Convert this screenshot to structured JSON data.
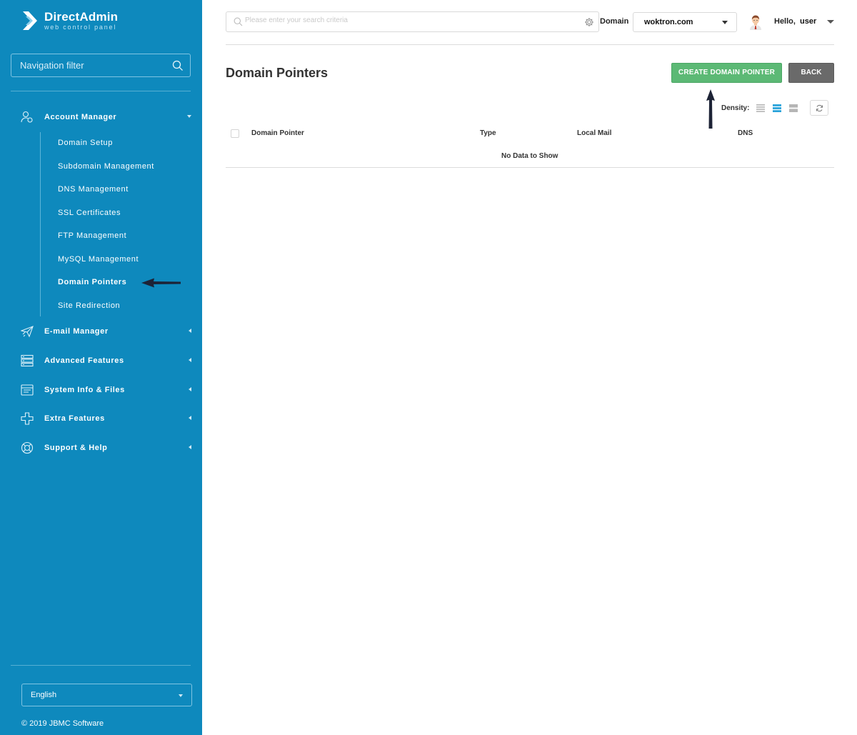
{
  "brand": {
    "name": "DirectAdmin",
    "tagline": "web control panel"
  },
  "sidebar": {
    "filter_placeholder": "Navigation filter",
    "groups": [
      {
        "label": "Account Manager",
        "icon": "account-manager-icon",
        "expanded": true
      },
      {
        "label": "E-mail Manager",
        "icon": "paper-plane-icon",
        "expanded": false
      },
      {
        "label": "Advanced Features",
        "icon": "server-list-icon",
        "expanded": false
      },
      {
        "label": "System Info & Files",
        "icon": "folder-icon",
        "expanded": false
      },
      {
        "label": "Extra Features",
        "icon": "plus-cross-icon",
        "expanded": false
      },
      {
        "label": "Support & Help",
        "icon": "lifebuoy-icon",
        "expanded": false
      }
    ],
    "account_items": [
      {
        "label": "Domain Setup"
      },
      {
        "label": "Subdomain Management"
      },
      {
        "label": "DNS Management"
      },
      {
        "label": "SSL Certificates"
      },
      {
        "label": "FTP Management"
      },
      {
        "label": "MySQL Management"
      },
      {
        "label": "Domain Pointers",
        "active": true
      },
      {
        "label": "Site Redirection"
      }
    ],
    "language": "English",
    "copyright": "© 2019 JBMC Software"
  },
  "topbar": {
    "search_placeholder": "Please enter your search criteria",
    "domain_label": "Domain",
    "domain_value": "woktron.com",
    "hello": "Hello,",
    "username": "user"
  },
  "main": {
    "title": "Domain Pointers",
    "create_button": "CREATE DOMAIN POINTER",
    "back_button": "BACK",
    "density_label": "Density:",
    "columns": [
      "Domain Pointer",
      "Type",
      "Local Mail",
      "DNS"
    ],
    "empty_text": "No Data to Show"
  },
  "colors": {
    "sidebar_bg": "#0e89bd",
    "create_button": "#5cb975",
    "back_button": "#6a6a6a",
    "density_active": "#2aa3da"
  }
}
